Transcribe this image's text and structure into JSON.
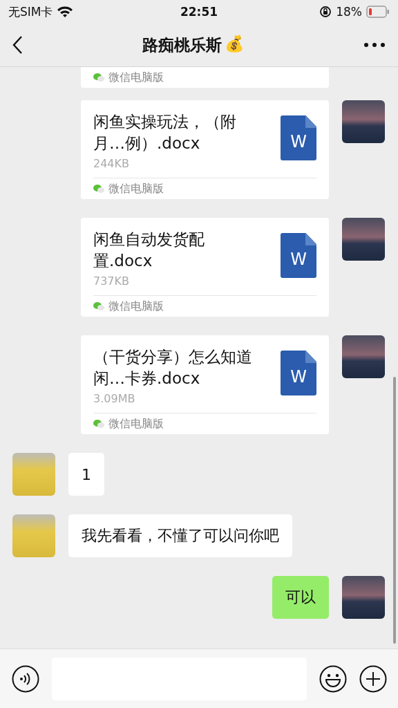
{
  "status_bar": {
    "carrier": "无SIM卡",
    "time": "22:51",
    "battery": "18%"
  },
  "nav": {
    "title": "路痴桃乐斯",
    "title_emoji": "💰"
  },
  "messages": [
    {
      "kind": "file_partial",
      "outgoing": true,
      "source": "微信电脑版"
    },
    {
      "kind": "file",
      "outgoing": true,
      "name": "闲鱼实操玩法，（附月…例）.docx",
      "size": "244KB",
      "icon_label": "W",
      "source": "微信电脑版"
    },
    {
      "kind": "file",
      "outgoing": true,
      "name": "闲鱼自动发货配置.docx",
      "size": "737KB",
      "icon_label": "W",
      "source": "微信电脑版"
    },
    {
      "kind": "file",
      "outgoing": true,
      "name": "（干货分享）怎么知道闲…卡券.docx",
      "size": "3.09MB",
      "icon_label": "W",
      "source": "微信电脑版"
    },
    {
      "kind": "text",
      "outgoing": false,
      "text": "1"
    },
    {
      "kind": "text",
      "outgoing": false,
      "text": "我先看看，不懂了可以问你吧"
    },
    {
      "kind": "text",
      "outgoing": true,
      "text": "可以"
    }
  ]
}
